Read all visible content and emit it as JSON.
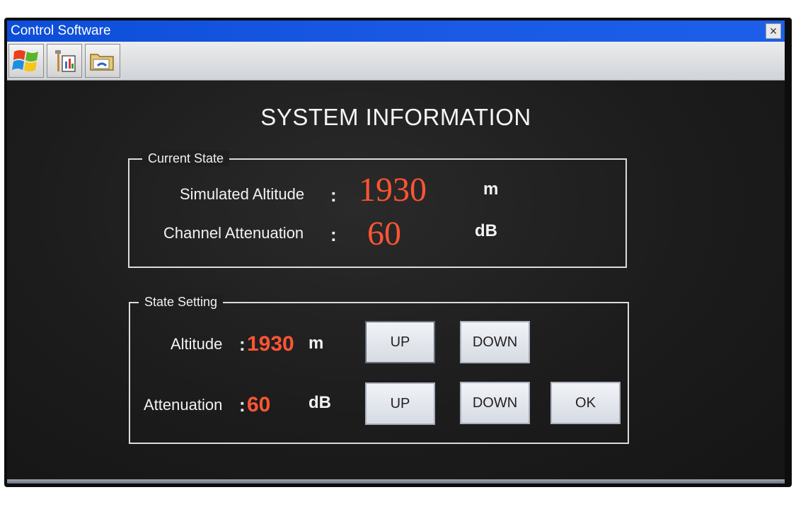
{
  "window": {
    "title": "Control Software",
    "close_label": "×"
  },
  "toolbar": {
    "buttons": [
      {
        "name": "windows-logo-icon"
      },
      {
        "name": "tools-settings-icon"
      },
      {
        "name": "folder-icon"
      }
    ]
  },
  "main": {
    "heading": "SYSTEM INFORMATION"
  },
  "current_state": {
    "legend": "Current State",
    "altitude_label": "Simulated Altitude",
    "altitude_colon": ":",
    "altitude_value": "1930",
    "altitude_unit": "m",
    "attenuation_label": "Channel Attenuation",
    "attenuation_colon": ":",
    "attenuation_value": "60",
    "attenuation_unit": "dB"
  },
  "state_setting": {
    "legend": "State Setting",
    "altitude_label": "Altitude",
    "altitude_colon": ":",
    "altitude_value": "1930",
    "altitude_unit": "m",
    "attenuation_label": "Attenuation",
    "attenuation_colon": ":",
    "attenuation_value": "60",
    "attenuation_unit": "dB",
    "altitude_up": "UP",
    "altitude_down": "DOWN",
    "attenuation_up": "UP",
    "attenuation_down": "DOWN",
    "ok": "OK"
  },
  "colors": {
    "value_red": "#ff5533",
    "titlebar_blue": "#1a5ae6",
    "panel_bg": "#1f1f1f"
  }
}
